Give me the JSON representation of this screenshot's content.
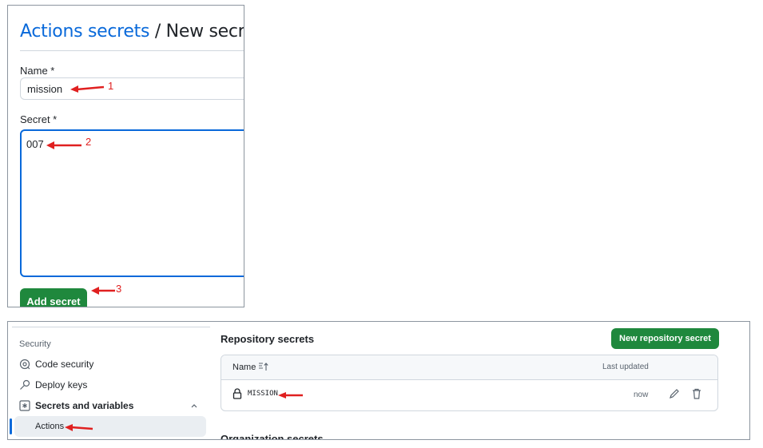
{
  "form": {
    "breadcrumb": "Actions secrets",
    "separator": "/",
    "title": "New secret",
    "name_label": "Name *",
    "name_value": "mission",
    "secret_label": "Secret *",
    "secret_value": "007",
    "add_button": "Add secret"
  },
  "sidebar": {
    "heading": "Security",
    "items": [
      {
        "label": "Code security",
        "icon": "codescan-icon"
      },
      {
        "label": "Deploy keys",
        "icon": "key-icon"
      },
      {
        "label": "Secrets and variables",
        "icon": "asterisk-icon"
      }
    ],
    "active_item": "Actions"
  },
  "repo_secrets": {
    "title": "Repository secrets",
    "new_button": "New repository secret",
    "col_name": "Name",
    "col_updated": "Last updated",
    "rows": [
      {
        "name": "MISSION",
        "updated": "now"
      }
    ]
  },
  "org_secrets": {
    "title": "Organization secrets"
  },
  "annotations": [
    "1",
    "2",
    "3"
  ],
  "colors": {
    "accent": "#0969da",
    "primary_button": "#1f883d",
    "annotation": "#e02020"
  }
}
